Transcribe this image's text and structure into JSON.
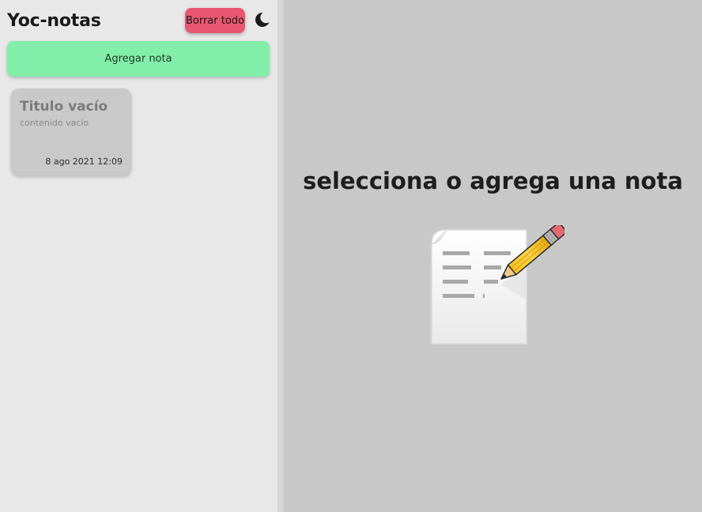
{
  "app": {
    "title": "Yoc-notas"
  },
  "toolbar": {
    "delete_all_label": "Borrar todo",
    "theme_icon": "moon-icon"
  },
  "actions": {
    "add_note_label": "Agregar nota"
  },
  "notes": [
    {
      "title": "Titulo vacío",
      "content": "contenido vacío",
      "date": "8 ago 2021 12:09"
    }
  ],
  "main": {
    "empty_message": "selecciona o agrega una nota",
    "illustration_icon": "note-pencil-icon"
  },
  "colors": {
    "delete_button": "#e8576f",
    "add_button": "#82eeaa",
    "sidebar_bg": "#e8e8e8",
    "main_bg": "#c8c8c8",
    "note_card_bg": "#c9c9c9"
  }
}
